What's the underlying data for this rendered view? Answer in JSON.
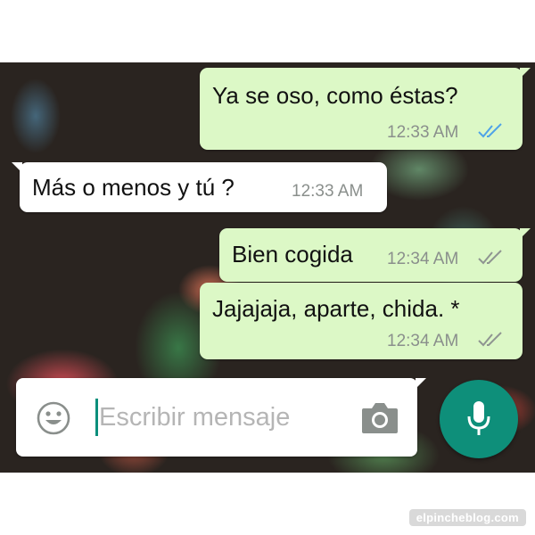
{
  "messages": [
    {
      "text": "Ya se oso, como éstas?",
      "time": "12:33 AM",
      "direction": "outgoing",
      "status": "read"
    },
    {
      "text": "Más o menos y tú ?",
      "time": "12:33 AM",
      "direction": "incoming"
    },
    {
      "text": "Bien cogida",
      "time": "12:34 AM",
      "direction": "outgoing",
      "status": "delivered"
    },
    {
      "text": "Jajajaja, aparte, chida. *",
      "time": "12:34 AM",
      "direction": "outgoing",
      "status": "delivered"
    }
  ],
  "composer": {
    "placeholder": "Escribir mensaje",
    "value": "",
    "left_icon": "emoji-icon",
    "right_icon": "camera-icon",
    "send_icon": "microphone-icon"
  },
  "watermark": "elpincheblog.com",
  "colors": {
    "outgoing_bubble": "#dcf8c6",
    "incoming_bubble": "#ffffff",
    "read_ticks": "#4fa3e8",
    "delivered_ticks": "#8f9591",
    "accent": "#0e8f7a"
  }
}
